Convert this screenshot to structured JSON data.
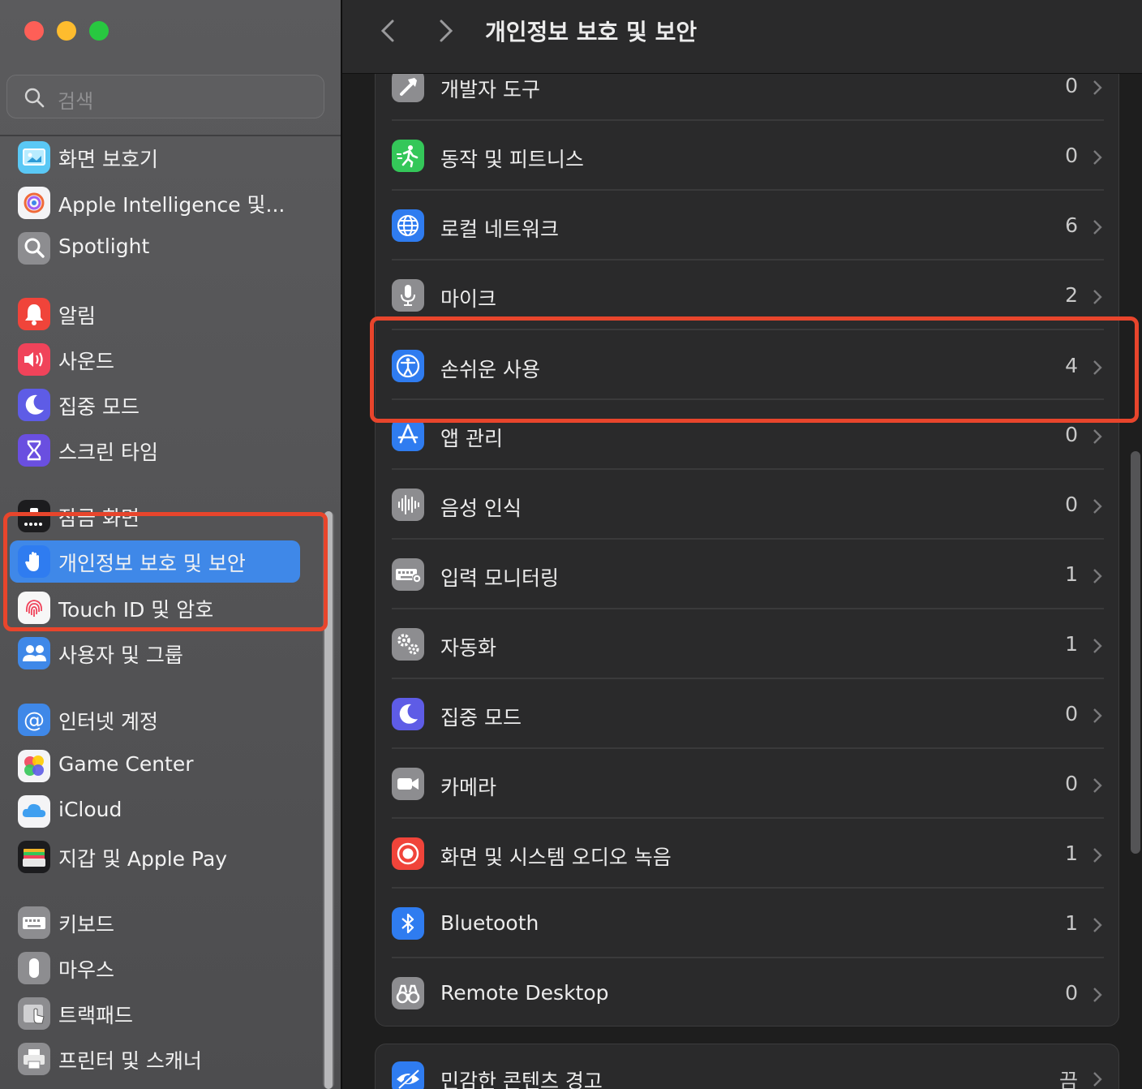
{
  "window": {
    "title": "개인정보 보호 및 보안"
  },
  "search": {
    "placeholder": "검색"
  },
  "sidebar": {
    "items": [
      {
        "label": "화면 보호기",
        "icon": "screensaver-icon"
      },
      {
        "label": "Apple Intelligence 및...",
        "icon": "apple-intelligence-icon"
      },
      {
        "label": "Spotlight",
        "icon": "spotlight-icon"
      },
      {
        "label": "알림",
        "icon": "notifications-icon"
      },
      {
        "label": "사운드",
        "icon": "sound-icon"
      },
      {
        "label": "집중 모드",
        "icon": "focus-moon-icon"
      },
      {
        "label": "스크린 타임",
        "icon": "screen-time-hourglass-icon"
      },
      {
        "label": "잠금 화면",
        "icon": "lock-screen-icon"
      },
      {
        "label": "개인정보 보호 및 보안",
        "icon": "privacy-hand-icon",
        "selected": true
      },
      {
        "label": "Touch ID 및 암호",
        "icon": "touch-id-fingerprint-icon"
      },
      {
        "label": "사용자 및 그룹",
        "icon": "users-groups-icon"
      },
      {
        "label": "인터넷 계정",
        "icon": "internet-accounts-at-icon"
      },
      {
        "label": "Game Center",
        "icon": "game-center-icon"
      },
      {
        "label": "iCloud",
        "icon": "icloud-icon"
      },
      {
        "label": "지갑 및 Apple Pay",
        "icon": "wallet-icon"
      },
      {
        "label": "키보드",
        "icon": "keyboard-icon"
      },
      {
        "label": "마우스",
        "icon": "mouse-icon"
      },
      {
        "label": "트랙패드",
        "icon": "trackpad-icon"
      },
      {
        "label": "프린터 및 스캐너",
        "icon": "printer-icon"
      }
    ]
  },
  "main": {
    "rows": [
      {
        "label": "개발자 도구",
        "count": "0",
        "icon": "developer-tools-hammer-icon"
      },
      {
        "label": "동작 및 피트니스",
        "count": "0",
        "icon": "motion-fitness-icon"
      },
      {
        "label": "로컬 네트워크",
        "count": "6",
        "icon": "local-network-globe-icon"
      },
      {
        "label": "마이크",
        "count": "2",
        "icon": "microphone-icon"
      },
      {
        "label": "손쉬운 사용",
        "count": "4",
        "icon": "accessibility-icon"
      },
      {
        "label": "앱 관리",
        "count": "0",
        "icon": "app-management-icon"
      },
      {
        "label": "음성 인식",
        "count": "0",
        "icon": "speech-recognition-icon"
      },
      {
        "label": "입력 모니터링",
        "count": "1",
        "icon": "input-monitoring-keyboard-icon"
      },
      {
        "label": "자동화",
        "count": "1",
        "icon": "automation-gears-icon"
      },
      {
        "label": "집중 모드",
        "count": "0",
        "icon": "focus-moon-icon"
      },
      {
        "label": "카메라",
        "count": "0",
        "icon": "camera-icon"
      },
      {
        "label": "화면 및 시스템 오디오 녹음",
        "count": "1",
        "icon": "screen-recording-icon"
      },
      {
        "label": "Bluetooth",
        "count": "1",
        "icon": "bluetooth-icon"
      },
      {
        "label": "Remote Desktop",
        "count": "0",
        "icon": "remote-desktop-binoculars-icon"
      }
    ],
    "sensitive": {
      "label": "민감한 콘텐츠 경고",
      "value": "끔",
      "icon": "sensitive-content-eye-icon"
    }
  },
  "colors": {
    "accent": "#3f88e8",
    "highlight_box": "#e8452c"
  }
}
